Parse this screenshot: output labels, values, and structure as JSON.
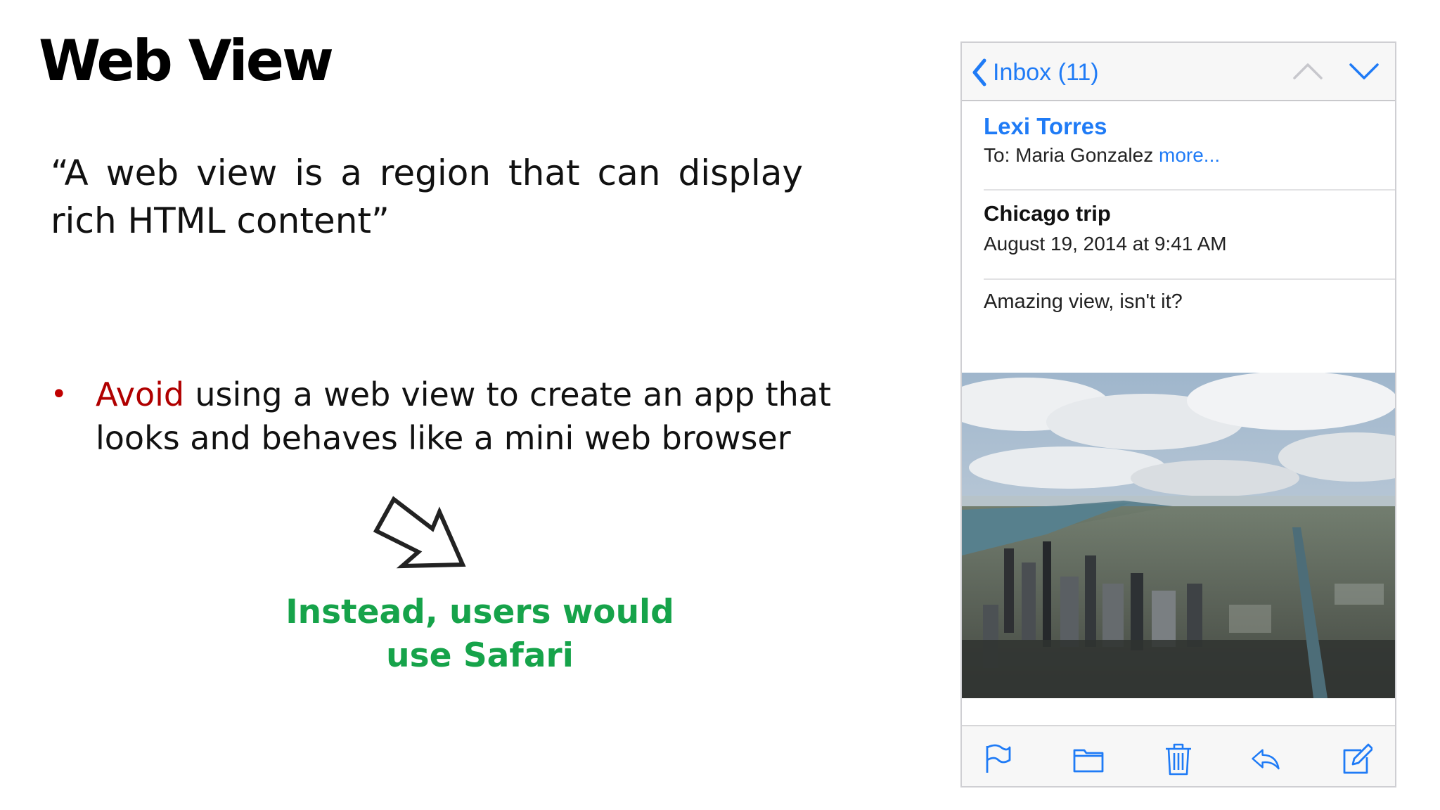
{
  "slide": {
    "title": "Web View",
    "quote": "“A web view is a region that can display rich HTML content”",
    "bullet": {
      "marker": "•",
      "highlight": "Avoid",
      "text": " using a web view to create an app that looks and behaves like a mini web browser"
    },
    "callout": {
      "line1": "Instead, users would",
      "line2": "use Safari"
    },
    "colors": {
      "avoid": "#b00000",
      "callout": "#16a34a"
    }
  },
  "mail": {
    "nav": {
      "back_label": "Inbox (11)"
    },
    "sender": "Lexi Torres",
    "to_prefix": "To: Maria Gonzalez",
    "more_link": "more...",
    "subject": "Chicago trip",
    "date": "August 19, 2014 at 9:41 AM",
    "body": "Amazing view, isn't it?",
    "toolbar_icons": [
      "flag-icon",
      "folder-icon",
      "trash-icon",
      "reply-icon",
      "compose-icon"
    ],
    "accent": "#1f7bf6"
  }
}
